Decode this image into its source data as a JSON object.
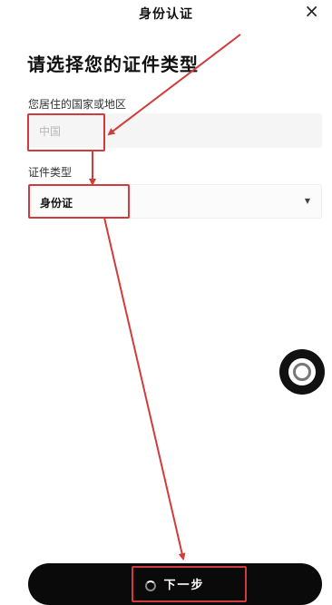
{
  "header": {
    "title": "身份认证",
    "close_icon": "close-icon"
  },
  "main": {
    "heading": "请选择您的证件类型",
    "region": {
      "label": "您居住的国家或地区",
      "value": "中国"
    },
    "id_type": {
      "label": "证件类型",
      "value": "身份证",
      "dropdown_icon": "caret-down-icon"
    }
  },
  "footer": {
    "next_label": "下一步",
    "loading_icon": "spinner-icon"
  },
  "floating": {
    "icon": "assistive-touch-icon"
  },
  "colors": {
    "annotation_red": "#d23b3b",
    "button_bg": "#0a0a0a"
  }
}
